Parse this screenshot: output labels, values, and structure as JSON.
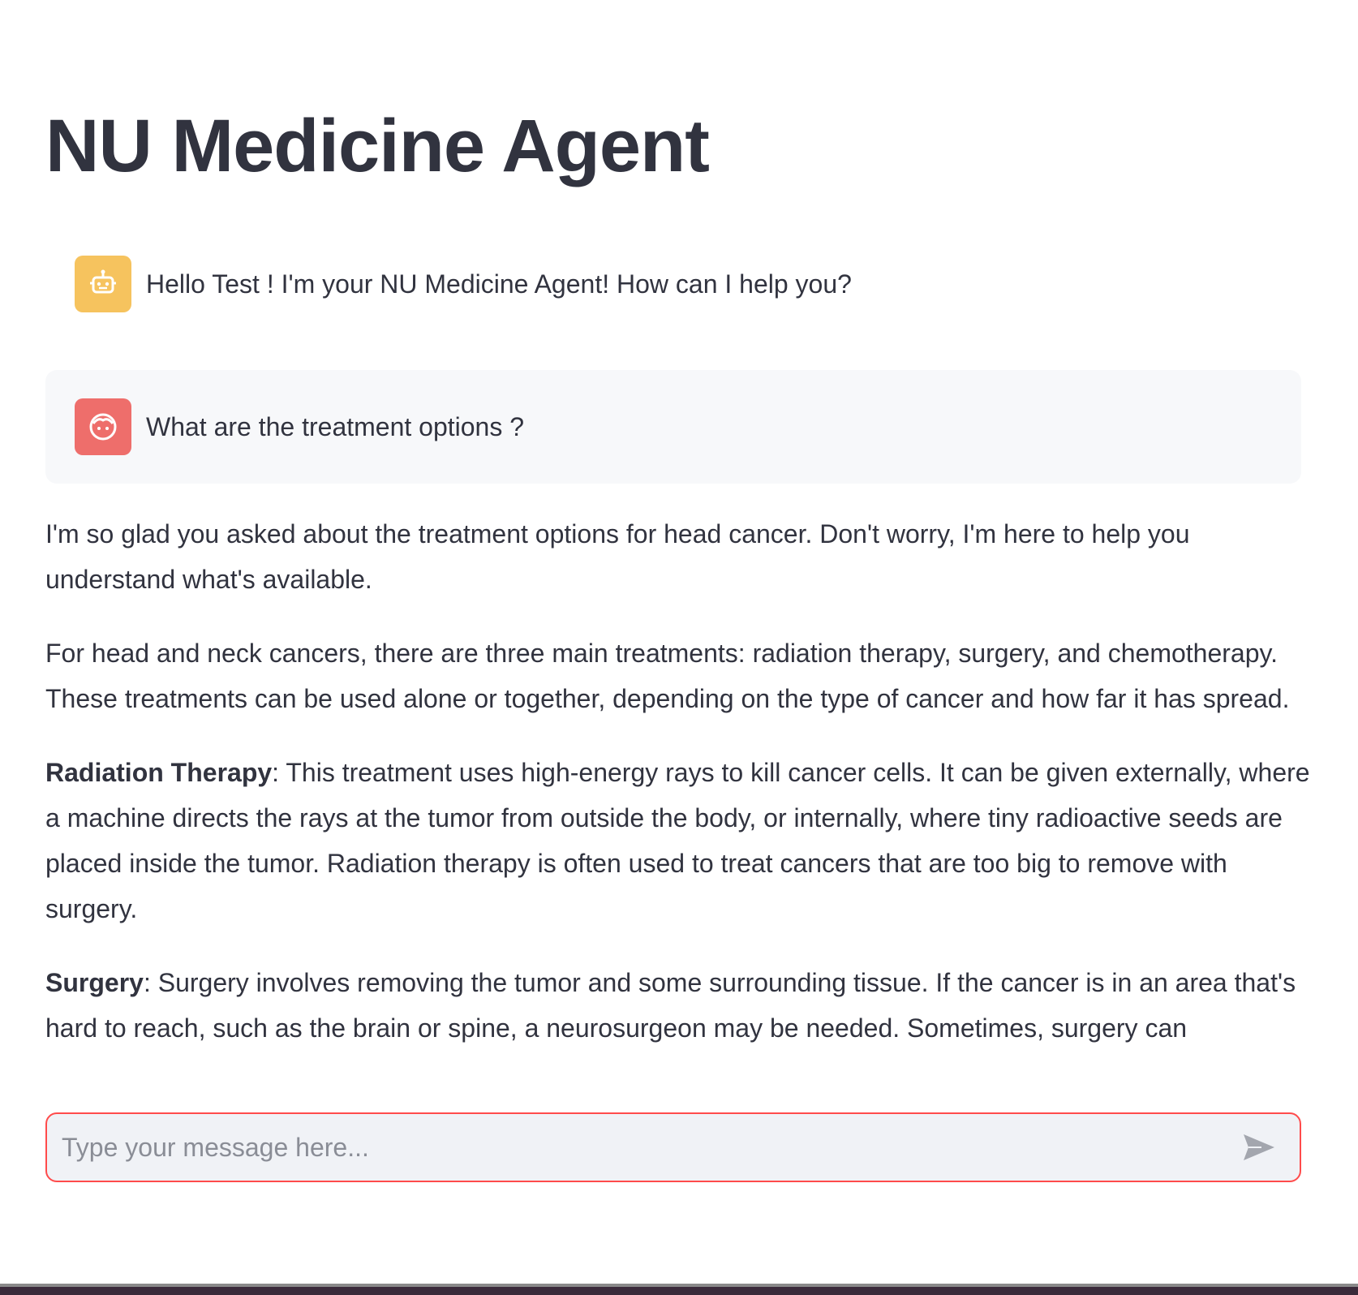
{
  "page": {
    "title": "NU Medicine Agent"
  },
  "messages": {
    "assistant_greeting": {
      "avatar_icon": "robot-icon",
      "avatar_color": "#f6c35e",
      "text": "Hello Test ! I'm your NU Medicine Agent! How can I help you?"
    },
    "user_question": {
      "avatar_icon": "face-icon",
      "avatar_color": "#ee6e6b",
      "text": "What are the treatment options ?"
    }
  },
  "response": {
    "p1": "I'm so glad you asked about the treatment options for head cancer. Don't worry, I'm here to help you understand what's available.",
    "p2": "For head and neck cancers, there are three main treatments: radiation therapy, surgery, and chemotherapy. These treatments can be used alone or together, depending on the type of cancer and how far it has spread.",
    "p3_label": "Radiation Therapy",
    "p3_text": ": This treatment uses high-energy rays to kill cancer cells. It can be given externally, where a machine directs the rays at the tumor from outside the body, or internally, where tiny radioactive seeds are placed inside the tumor. Radiation therapy is often used to treat cancers that are too big to remove with surgery.",
    "p4_label": "Surgery",
    "p4_text": ": Surgery involves removing the tumor and some surrounding tissue. If the cancer is in an area that's hard to reach, such as the brain or spine, a neurosurgeon may be needed. Sometimes, surgery can"
  },
  "chat_input": {
    "placeholder": "Type your message here...",
    "value": "",
    "border_color": "#ff4b4b",
    "send_icon": "send-icon"
  }
}
